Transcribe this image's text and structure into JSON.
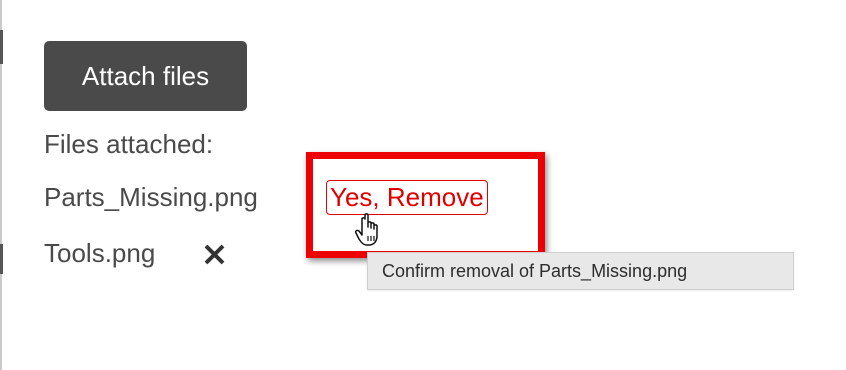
{
  "attach_button": {
    "label": "Attach files"
  },
  "files_section": {
    "label": "Files attached:",
    "files": [
      {
        "name": "Parts_Missing.png",
        "action_label": "Yes, Remove"
      },
      {
        "name": "Tools.png",
        "remove_icon": "close-x-icon"
      }
    ]
  },
  "tooltip": {
    "text": "Confirm removal of Parts_Missing.png"
  },
  "colors": {
    "button_bg": "#4a4a4a",
    "text": "#4a4a4a",
    "danger": "#e00000",
    "highlight": "#ee0000",
    "tooltip_bg": "#e8e8e8"
  },
  "icons": {
    "cursor": "hand-pointer-icon",
    "remove": "close-x-icon"
  }
}
